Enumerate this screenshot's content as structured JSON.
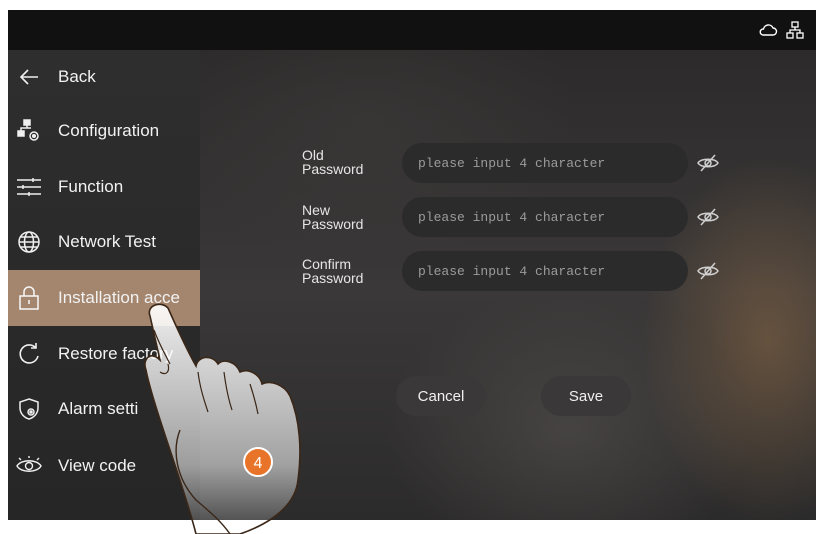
{
  "status_icons": [
    "cloud-icon",
    "network-icon"
  ],
  "sidebar": {
    "items": [
      {
        "label": "Back",
        "icon": "arrow-left-icon"
      },
      {
        "label": "Configuration",
        "icon": "configuration-icon"
      },
      {
        "label": "Function",
        "icon": "sliders-icon"
      },
      {
        "label": "Network Test",
        "icon": "globe-icon"
      },
      {
        "label": "Installation acce",
        "icon": "lock-icon",
        "active": true
      },
      {
        "label": "Restore factory",
        "icon": "restore-icon"
      },
      {
        "label": "Alarm setti",
        "icon": "alarm-shield-icon"
      },
      {
        "label": "View code",
        "icon": "eye-icon"
      }
    ]
  },
  "form": {
    "old_label_1": "Old",
    "old_label_2": "Password",
    "new_label_1": "New",
    "new_label_2": "Password",
    "confirm_label_1": "Confirm",
    "confirm_label_2": "Password",
    "placeholder": "please input 4 character",
    "cancel": "Cancel",
    "save": "Save"
  },
  "step_number": "4",
  "colors": {
    "active_item": "#a4866f",
    "step_badge": "#e8742a"
  }
}
